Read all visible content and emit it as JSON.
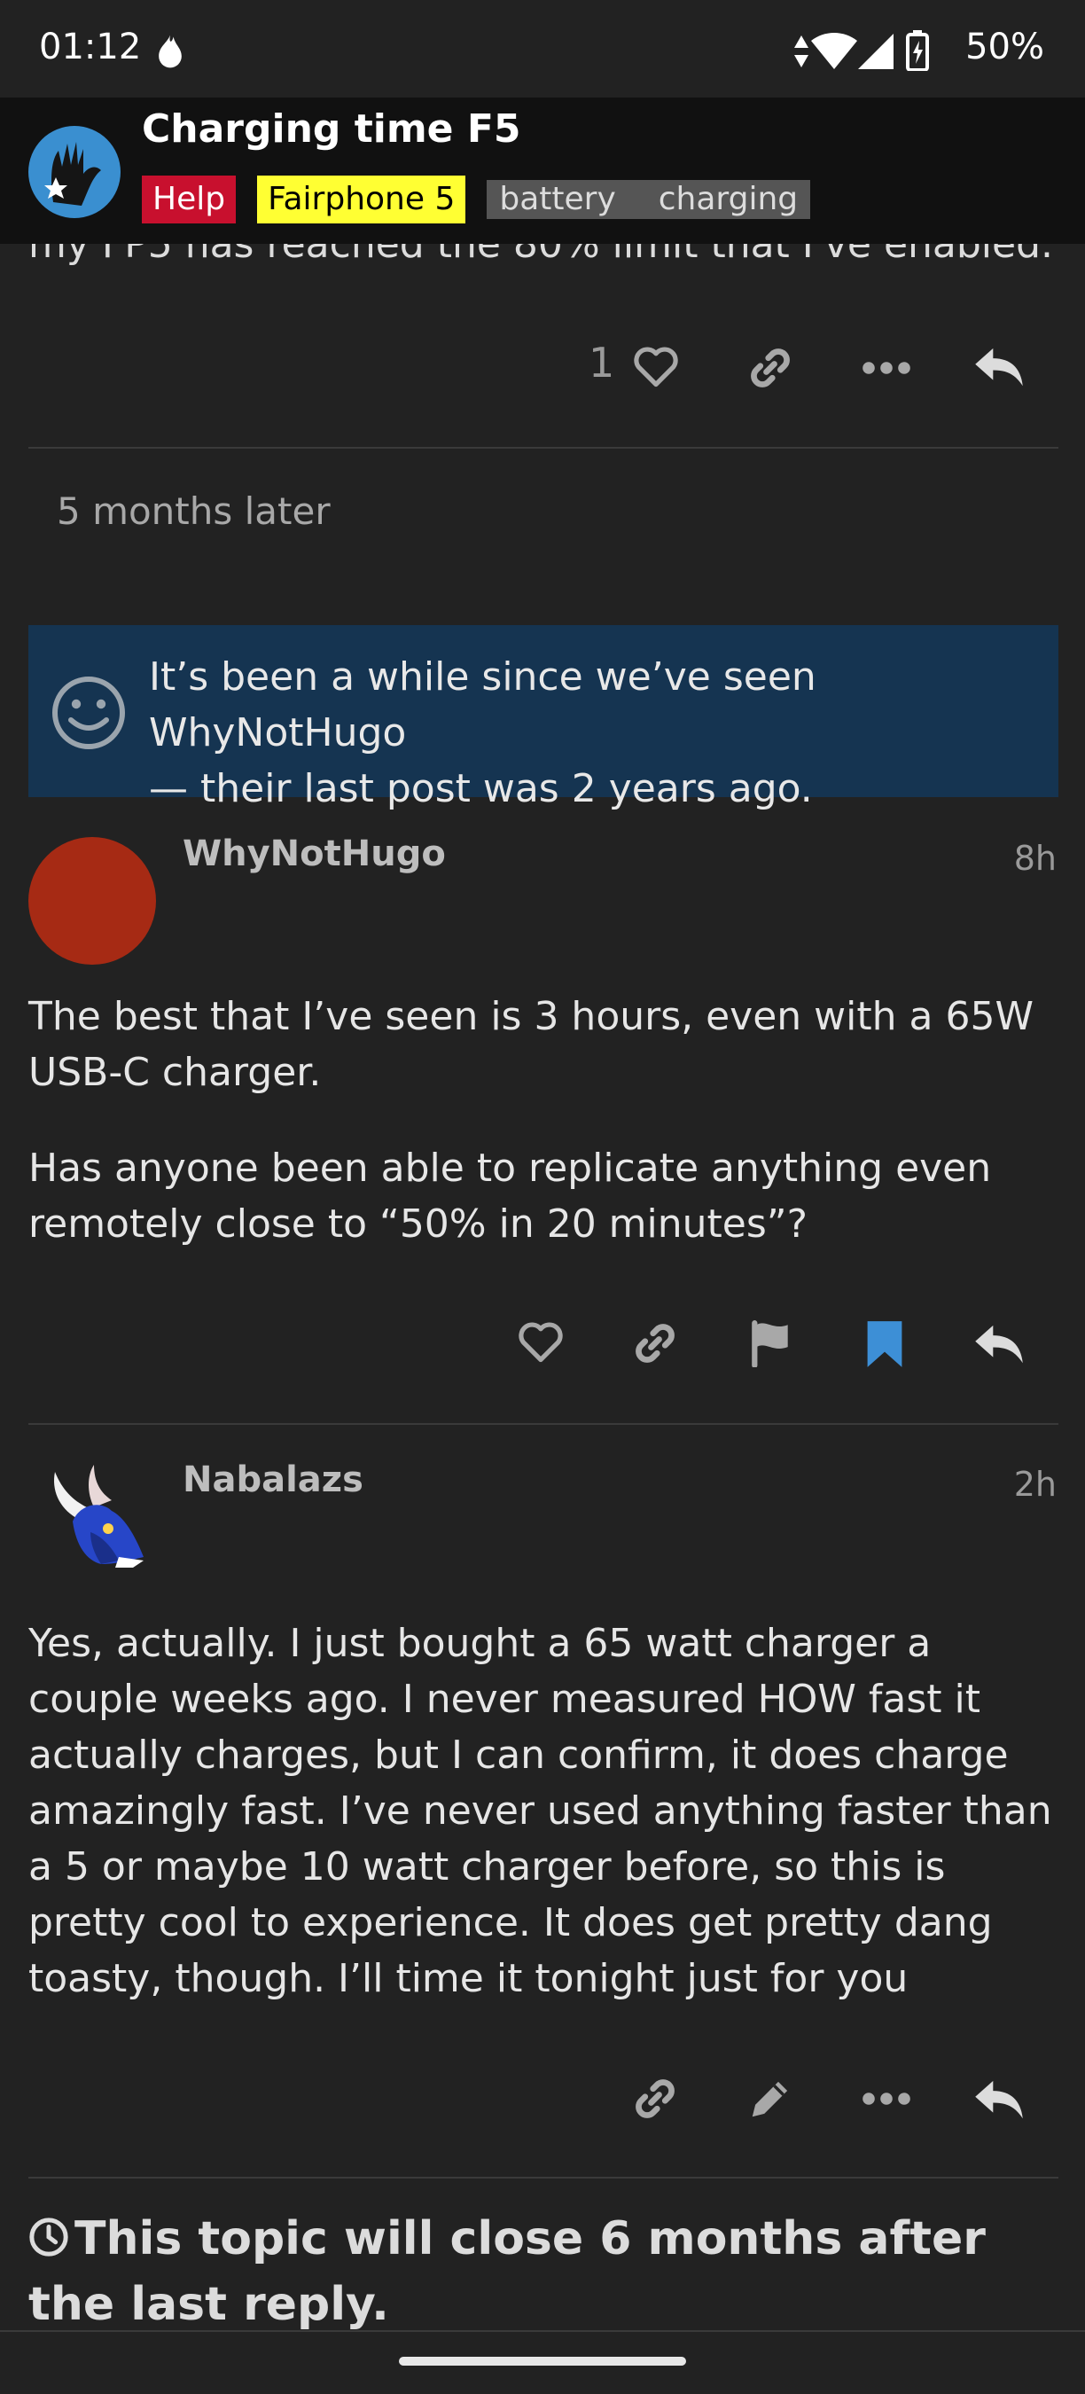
{
  "status_bar": {
    "time": "01:12",
    "battery": "50%"
  },
  "topic": {
    "title": "Charging time F5",
    "tags": {
      "category": "Help",
      "subcategory": "Fairphone 5",
      "tag1": "battery",
      "tag2": "charging"
    }
  },
  "previous_post": {
    "cut_text": "my FP5 has reached the 80% limit that I've enabled.",
    "like_count": "1"
  },
  "small_action": "5 months later",
  "notice": {
    "line1": "It’s been a while since we’ve seen WhyNotHugo",
    "line2": "— their last post was 2 years ago."
  },
  "posts": [
    {
      "username": "WhyNotHugo",
      "time": "8h",
      "paragraph1": "The best that I’ve seen is 3 hours, even with a 65W USB-C charger.",
      "paragraph2": "Has anyone been able to replicate anything even remotely close to “50% in 20 minutes”?"
    },
    {
      "username": "Nabalazs",
      "time": "2h",
      "paragraph1": "Yes, actually. I just bought a 65 watt charger a couple weeks ago. I never measured HOW fast it actually charges, but I can confirm, it does charge amazingly fast. I’ve never used anything faster than a 5 or maybe 10 watt charger before, so this is pretty cool to experience. It does get pretty dang toasty, though. I’ll time it tonight just for you"
    }
  ],
  "topic_close_message": "This topic will close 6 months after the last reply.",
  "colors": {
    "background": "#222222",
    "header": "#111111",
    "notice_bg": "#153451",
    "help_tag": "#c8102e",
    "fairphone_tag": "#ffff33",
    "bookmark_active": "#3d8fd6",
    "avatar_whynothugo": "#a62a14"
  }
}
